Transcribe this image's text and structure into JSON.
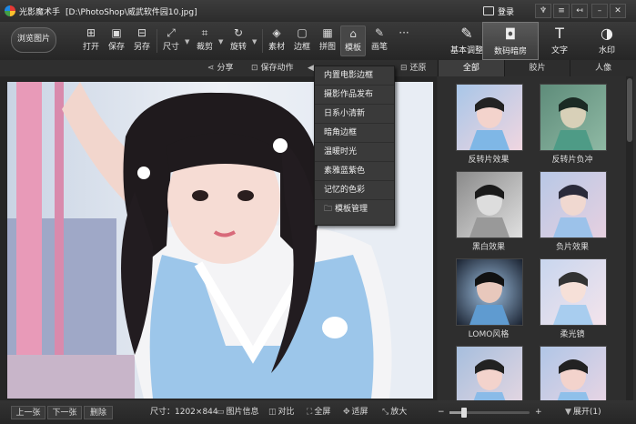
{
  "title": {
    "app": "光影魔术手",
    "filepath": "[D:\\PhotoShop\\威武软件园10.jpg]"
  },
  "login": "登录",
  "window": {
    "restore": "↤",
    "skin": "♆",
    "menu": "≡",
    "minimize": "–",
    "maximize": "□",
    "close": "✕"
  },
  "toolbar": {
    "browse": "浏览图片",
    "tools": [
      {
        "label": "打开",
        "icon": "⊞"
      },
      {
        "label": "保存",
        "icon": "▣"
      },
      {
        "label": "另存",
        "icon": "⊟"
      },
      {
        "label": "尺寸",
        "icon": "⤢"
      },
      {
        "label": "裁剪",
        "icon": "⌗"
      },
      {
        "label": "旋转",
        "icon": "↻"
      },
      {
        "label": "素材",
        "icon": "◈"
      },
      {
        "label": "边框",
        "icon": "▢"
      },
      {
        "label": "拼图",
        "icon": "▦"
      },
      {
        "label": "模板",
        "icon": "⌂"
      },
      {
        "label": "画笔",
        "icon": "✎"
      },
      {
        "label": "",
        "icon": "···"
      }
    ],
    "right": [
      {
        "label": "基本调整",
        "icon": "✎"
      },
      {
        "label": "数码暗房",
        "icon": "◘"
      },
      {
        "label": "文字",
        "icon": "T"
      },
      {
        "label": "水印",
        "icon": "◑"
      }
    ]
  },
  "actions": {
    "share": "分享",
    "save_action": "保存动作",
    "restore": "还原"
  },
  "template_menu": [
    "内置电影边框",
    "摄影作品发布",
    "日系小清新",
    "暗角边框",
    "温暖时光",
    "素雅蓝紫色",
    "记忆的色彩",
    "模板管理"
  ],
  "panel_tabs": [
    "全部",
    "胶片",
    "人像"
  ],
  "effects": [
    "反转片效果",
    "反转片负冲",
    "黑白效果",
    "负片效果",
    "LOMO风格",
    "柔光镜",
    "",
    ""
  ],
  "status": {
    "prev": "上一张",
    "next": "下一张",
    "delete": "删除",
    "size": "尺寸：1202×844",
    "info": "图片信息",
    "compare": "对比",
    "fullscreen": "全屏",
    "fit": "适屏",
    "zoomin": "放大",
    "minus": "−",
    "plus": "+",
    "expand": "展开(1)",
    "zoom_level": 0.18
  },
  "colors": {
    "accent": "#3a8fd6",
    "bg": "#2b2b2b"
  }
}
